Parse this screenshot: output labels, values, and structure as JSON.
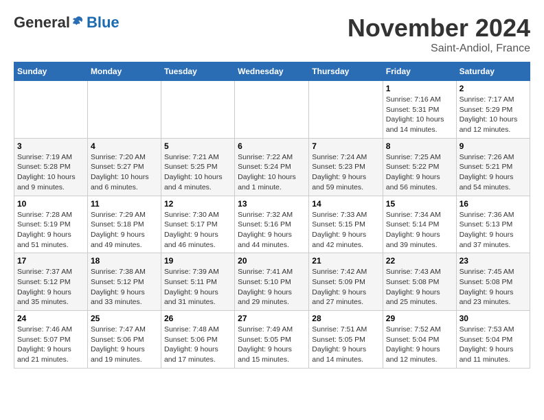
{
  "logo": {
    "general": "General",
    "blue": "Blue"
  },
  "header": {
    "title": "November 2024",
    "subtitle": "Saint-Andiol, France"
  },
  "weekdays": [
    "Sunday",
    "Monday",
    "Tuesday",
    "Wednesday",
    "Thursday",
    "Friday",
    "Saturday"
  ],
  "weeks": [
    [
      {
        "day": "",
        "info": ""
      },
      {
        "day": "",
        "info": ""
      },
      {
        "day": "",
        "info": ""
      },
      {
        "day": "",
        "info": ""
      },
      {
        "day": "",
        "info": ""
      },
      {
        "day": "1",
        "info": "Sunrise: 7:16 AM\nSunset: 5:31 PM\nDaylight: 10 hours and 14 minutes."
      },
      {
        "day": "2",
        "info": "Sunrise: 7:17 AM\nSunset: 5:29 PM\nDaylight: 10 hours and 12 minutes."
      }
    ],
    [
      {
        "day": "3",
        "info": "Sunrise: 7:19 AM\nSunset: 5:28 PM\nDaylight: 10 hours and 9 minutes."
      },
      {
        "day": "4",
        "info": "Sunrise: 7:20 AM\nSunset: 5:27 PM\nDaylight: 10 hours and 6 minutes."
      },
      {
        "day": "5",
        "info": "Sunrise: 7:21 AM\nSunset: 5:25 PM\nDaylight: 10 hours and 4 minutes."
      },
      {
        "day": "6",
        "info": "Sunrise: 7:22 AM\nSunset: 5:24 PM\nDaylight: 10 hours and 1 minute."
      },
      {
        "day": "7",
        "info": "Sunrise: 7:24 AM\nSunset: 5:23 PM\nDaylight: 9 hours and 59 minutes."
      },
      {
        "day": "8",
        "info": "Sunrise: 7:25 AM\nSunset: 5:22 PM\nDaylight: 9 hours and 56 minutes."
      },
      {
        "day": "9",
        "info": "Sunrise: 7:26 AM\nSunset: 5:21 PM\nDaylight: 9 hours and 54 minutes."
      }
    ],
    [
      {
        "day": "10",
        "info": "Sunrise: 7:28 AM\nSunset: 5:19 PM\nDaylight: 9 hours and 51 minutes."
      },
      {
        "day": "11",
        "info": "Sunrise: 7:29 AM\nSunset: 5:18 PM\nDaylight: 9 hours and 49 minutes."
      },
      {
        "day": "12",
        "info": "Sunrise: 7:30 AM\nSunset: 5:17 PM\nDaylight: 9 hours and 46 minutes."
      },
      {
        "day": "13",
        "info": "Sunrise: 7:32 AM\nSunset: 5:16 PM\nDaylight: 9 hours and 44 minutes."
      },
      {
        "day": "14",
        "info": "Sunrise: 7:33 AM\nSunset: 5:15 PM\nDaylight: 9 hours and 42 minutes."
      },
      {
        "day": "15",
        "info": "Sunrise: 7:34 AM\nSunset: 5:14 PM\nDaylight: 9 hours and 39 minutes."
      },
      {
        "day": "16",
        "info": "Sunrise: 7:36 AM\nSunset: 5:13 PM\nDaylight: 9 hours and 37 minutes."
      }
    ],
    [
      {
        "day": "17",
        "info": "Sunrise: 7:37 AM\nSunset: 5:12 PM\nDaylight: 9 hours and 35 minutes."
      },
      {
        "day": "18",
        "info": "Sunrise: 7:38 AM\nSunset: 5:12 PM\nDaylight: 9 hours and 33 minutes."
      },
      {
        "day": "19",
        "info": "Sunrise: 7:39 AM\nSunset: 5:11 PM\nDaylight: 9 hours and 31 minutes."
      },
      {
        "day": "20",
        "info": "Sunrise: 7:41 AM\nSunset: 5:10 PM\nDaylight: 9 hours and 29 minutes."
      },
      {
        "day": "21",
        "info": "Sunrise: 7:42 AM\nSunset: 5:09 PM\nDaylight: 9 hours and 27 minutes."
      },
      {
        "day": "22",
        "info": "Sunrise: 7:43 AM\nSunset: 5:08 PM\nDaylight: 9 hours and 25 minutes."
      },
      {
        "day": "23",
        "info": "Sunrise: 7:45 AM\nSunset: 5:08 PM\nDaylight: 9 hours and 23 minutes."
      }
    ],
    [
      {
        "day": "24",
        "info": "Sunrise: 7:46 AM\nSunset: 5:07 PM\nDaylight: 9 hours and 21 minutes."
      },
      {
        "day": "25",
        "info": "Sunrise: 7:47 AM\nSunset: 5:06 PM\nDaylight: 9 hours and 19 minutes."
      },
      {
        "day": "26",
        "info": "Sunrise: 7:48 AM\nSunset: 5:06 PM\nDaylight: 9 hours and 17 minutes."
      },
      {
        "day": "27",
        "info": "Sunrise: 7:49 AM\nSunset: 5:05 PM\nDaylight: 9 hours and 15 minutes."
      },
      {
        "day": "28",
        "info": "Sunrise: 7:51 AM\nSunset: 5:05 PM\nDaylight: 9 hours and 14 minutes."
      },
      {
        "day": "29",
        "info": "Sunrise: 7:52 AM\nSunset: 5:04 PM\nDaylight: 9 hours and 12 minutes."
      },
      {
        "day": "30",
        "info": "Sunrise: 7:53 AM\nSunset: 5:04 PM\nDaylight: 9 hours and 11 minutes."
      }
    ]
  ]
}
